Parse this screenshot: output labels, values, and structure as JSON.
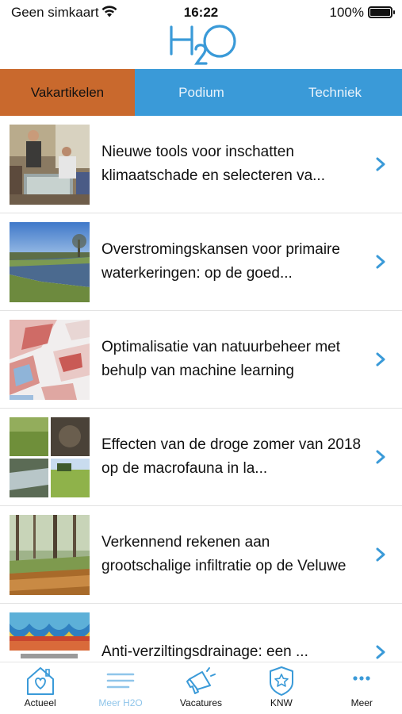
{
  "status_bar": {
    "carrier": "Geen simkaart",
    "time": "16:22",
    "battery": "100%"
  },
  "app": {
    "logo_text": "H2O",
    "brand_color": "#3a9ad8",
    "accent_color": "#c9692d"
  },
  "tabs": [
    {
      "label": "Vakartikelen",
      "active": true
    },
    {
      "label": "Podium",
      "active": false
    },
    {
      "label": "Techniek",
      "active": false
    }
  ],
  "articles": [
    {
      "title": "Nieuwe tools voor inschatten klimaatschade en selecteren va...",
      "thumb": "meeting-photo"
    },
    {
      "title": "Overstromingskansen voor primaire waterkeringen: op de goed...",
      "thumb": "river-dike-photo"
    },
    {
      "title": "Optimalisatie van natuurbeheer met behulp van machine learning",
      "thumb": "map-raster-image"
    },
    {
      "title": "Effecten van de droge zomer van 2018 op de macrofauna in la...",
      "thumb": "stream-photo-grid"
    },
    {
      "title": "Verkennend rekenen aan grootschalige infiltratie op de Veluwe",
      "thumb": "forest-stream-photo"
    },
    {
      "title": "Anti-verziltingsdrainage: een ...",
      "thumb": "salinity-chart-image"
    }
  ],
  "bottom_nav": [
    {
      "label": "Actueel",
      "icon": "home-heart-icon",
      "active": false
    },
    {
      "label": "Meer H2O",
      "icon": "lines-icon",
      "active": true
    },
    {
      "label": "Vacatures",
      "icon": "megaphone-icon",
      "active": false
    },
    {
      "label": "KNW",
      "icon": "badge-star-icon",
      "active": false
    },
    {
      "label": "Meer",
      "icon": "more-dots-icon",
      "active": false
    }
  ]
}
